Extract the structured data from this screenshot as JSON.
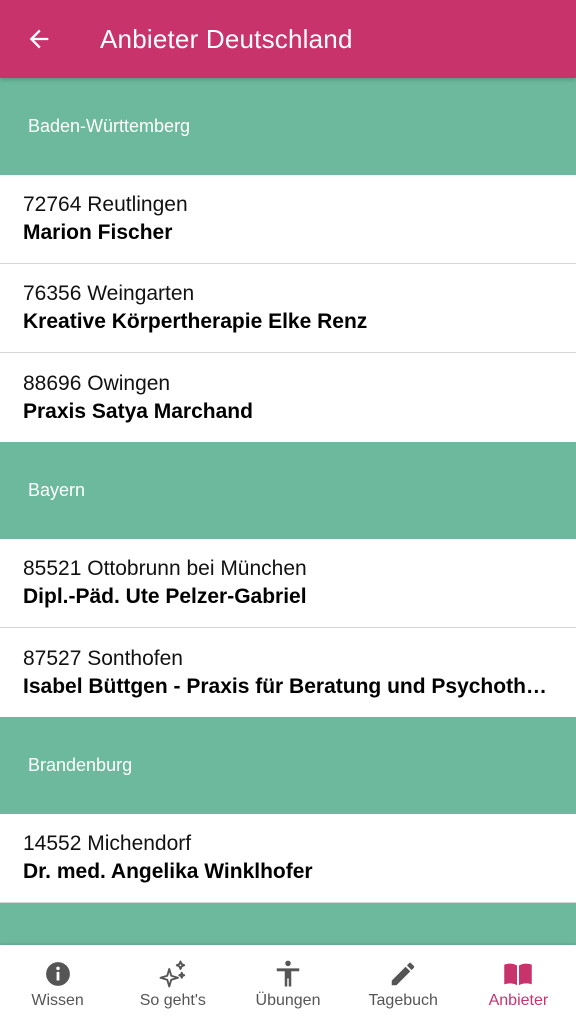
{
  "appbar": {
    "title": "Anbieter Deutschland"
  },
  "sections": [
    {
      "region": "Baden-Württemberg",
      "items": [
        {
          "location": "72764 Reutlingen",
          "name": "Marion Fischer"
        },
        {
          "location": "76356 Weingarten",
          "name": "Kreative Körpertherapie Elke Renz"
        },
        {
          "location": "88696 Owingen",
          "name": "Praxis Satya Marchand"
        }
      ]
    },
    {
      "region": "Bayern",
      "items": [
        {
          "location": "85521 Ottobrunn bei München",
          "name": "Dipl.-Päd. Ute Pelzer-Gabriel"
        },
        {
          "location": "87527 Sonthofen",
          "name": "Isabel Büttgen - Praxis für Beratung und Psychotherapie"
        }
      ]
    },
    {
      "region": "Brandenburg",
      "items": [
        {
          "location": "14552 Michendorf",
          "name": "Dr. med. Angelika Winklhofer"
        }
      ]
    }
  ],
  "bottom_nav": [
    {
      "label": "Wissen",
      "icon": "info-icon",
      "active": false
    },
    {
      "label": "So geht's",
      "icon": "sparkles-icon",
      "active": false
    },
    {
      "label": "Übungen",
      "icon": "accessibility-icon",
      "active": false
    },
    {
      "label": "Tagebuch",
      "icon": "pencil-icon",
      "active": false
    },
    {
      "label": "Anbieter",
      "icon": "book-icon",
      "active": true
    }
  ],
  "colors": {
    "primary": "#c8336c",
    "section_header": "#6cb99d",
    "nav_inactive": "#555555"
  }
}
